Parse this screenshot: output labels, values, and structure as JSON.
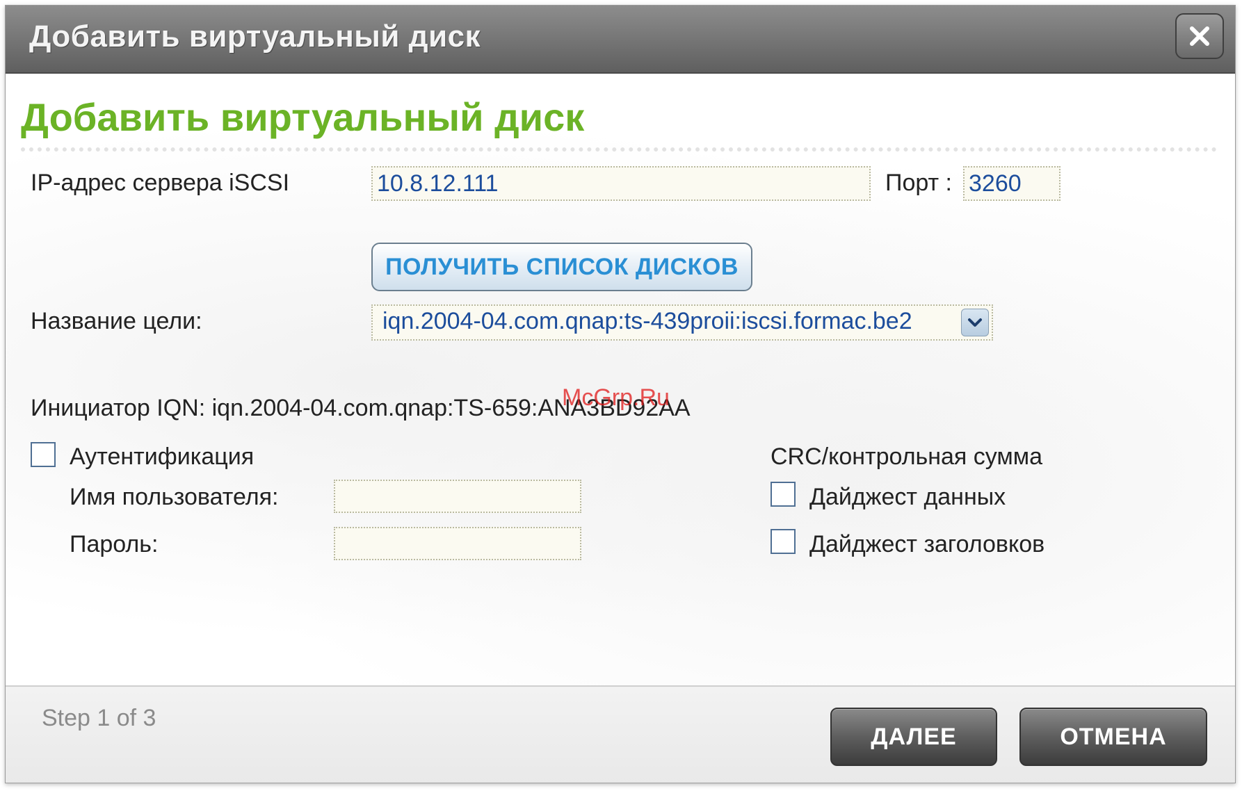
{
  "window": {
    "title": "Добавить виртуальный диск",
    "close_icon": "close-icon"
  },
  "page": {
    "heading": "Добавить виртуальный диск"
  },
  "server": {
    "ip_label": "IP-адрес сервера iSCSI",
    "ip_value": "10.8.12.111",
    "port_label": "Порт :",
    "port_value": "3260",
    "get_disks_button": "ПОЛУЧИТЬ СПИСОК ДИСКОВ"
  },
  "target": {
    "label": "Название цели:",
    "selected": "iqn.2004-04.com.qnap:ts-439proii:iscsi.formac.be2",
    "dropdown_icon": "chevron-down-icon"
  },
  "initiator": {
    "text": "Инициатор IQN: iqn.2004-04.com.qnap:TS-659:ANA3BD92AA"
  },
  "watermark": "McGrp.Ru",
  "auth": {
    "checkbox_label": "Аутентификация",
    "checked": false,
    "username_label": "Имя пользователя:",
    "username_value": "",
    "password_label": "Пароль:",
    "password_value": ""
  },
  "crc": {
    "heading": "CRC/контрольная сумма",
    "data_digest_label": "Дайджест данных",
    "data_digest_checked": false,
    "header_digest_label": "Дайджест заголовков",
    "header_digest_checked": false
  },
  "footer": {
    "step_text": "Step 1 of 3",
    "next_button": "ДАЛЕЕ",
    "cancel_button": "ОТМЕНА"
  },
  "colors": {
    "heading_green": "#6bb326",
    "field_text_blue": "#1c4d9c",
    "button_text_blue": "#2a8fd4",
    "titlebar_gray": "#767676"
  }
}
